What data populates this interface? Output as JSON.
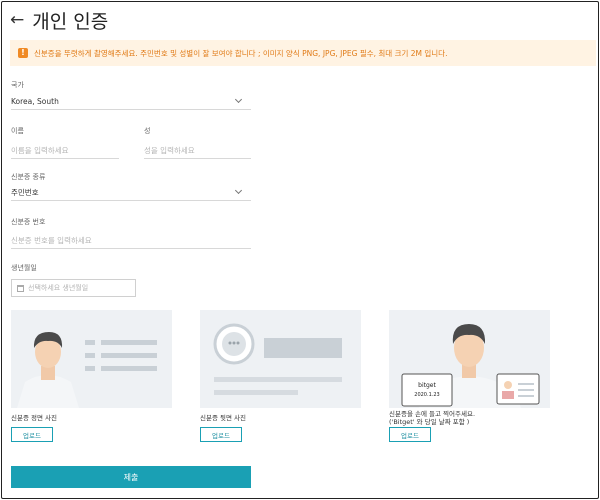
{
  "header": {
    "title": "개인 인증"
  },
  "notice": {
    "text": "신분증을 뚜렷하게 촬영해주세요. 주민번호 및 성별이 잘 보여야 합니다 ; 이미지 양식 PNG, JPG, JPEG 필수, 최대 크기 2M 입니다."
  },
  "form": {
    "country_label": "국가",
    "country_value": "Korea, South",
    "first_name_label": "이름",
    "first_name_placeholder": "이름을 입력하세요",
    "last_name_label": "성",
    "last_name_placeholder": "성을 입력하세요",
    "id_type_label": "신분증 종류",
    "id_type_value": "주민번호",
    "id_number_label": "신분증 번호",
    "id_number_placeholder": "신분증 번호를 입력하세요",
    "birth_label": "생년월일",
    "birth_placeholder": "선택하세요 생년월일"
  },
  "uploads": [
    {
      "caption": "신분증 정면 사진",
      "button": "업로드"
    },
    {
      "caption": "신분증 뒷면 사진",
      "button": "업로드"
    },
    {
      "caption": "신분증을 손에 들고 찍어주세요. ('Bitget' 와 당일 날짜 포함 )",
      "button": "업로드"
    }
  ],
  "selfie_card": {
    "brand": "bitget",
    "date": "2020.1.23"
  },
  "submit_label": "제출",
  "colors": {
    "accent": "#1aa0b4",
    "notice_bg": "#fff3e3",
    "notice_text": "#e07a16"
  }
}
